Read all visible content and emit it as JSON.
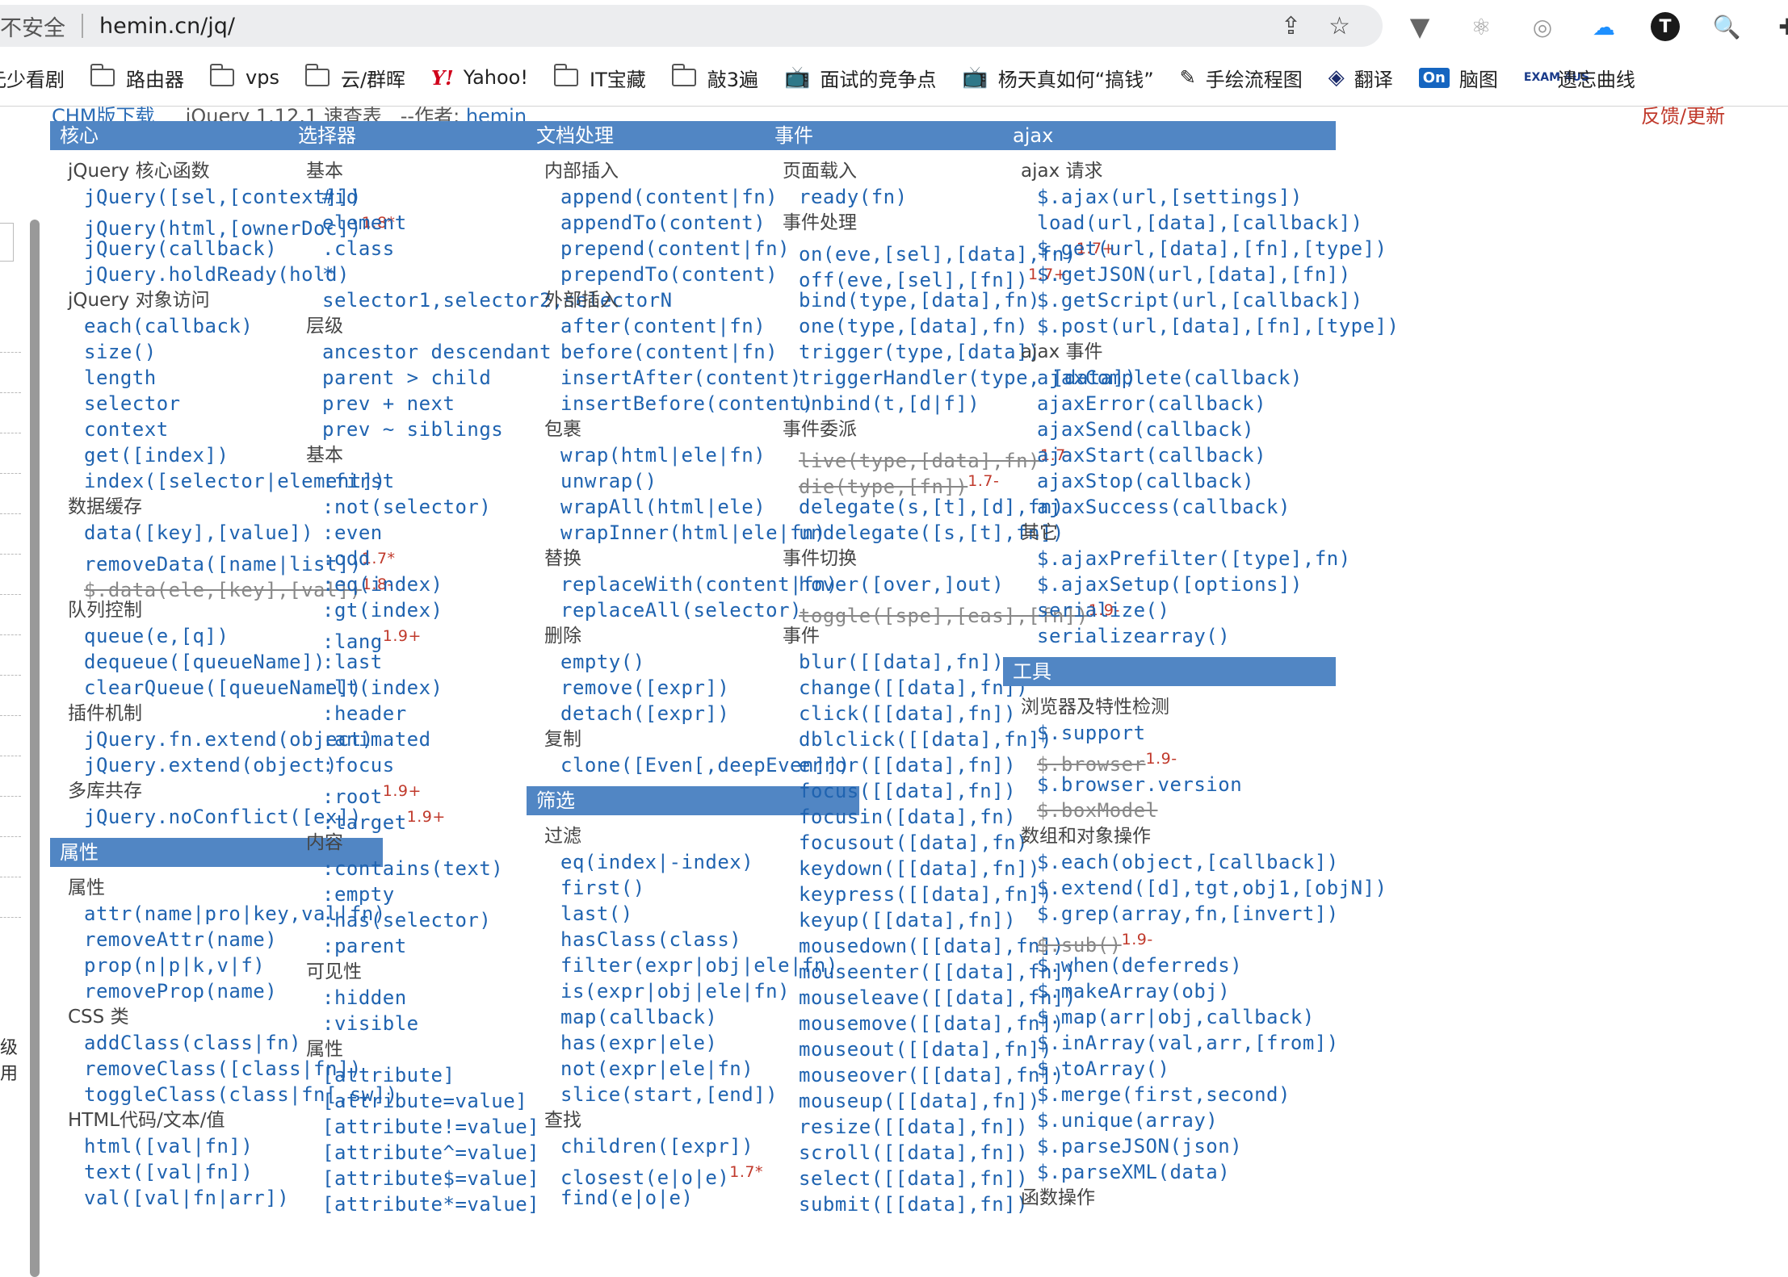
{
  "browser": {
    "security_text": "不安全",
    "url": "hemin.cn/jq/",
    "share_icon": "share-icon",
    "bookmark_star_icon": "star-icon",
    "extensions": [
      "vivaldi-icon",
      "react-icon",
      "camera-icon",
      "cloud-icon",
      "typora-icon",
      "zoom-icon",
      "puzzle-icon"
    ],
    "ext_glyph_t": "T"
  },
  "bookmarks": [
    {
      "type": "text",
      "label": "元少看剧"
    },
    {
      "type": "folder",
      "label": "路由器"
    },
    {
      "type": "folder",
      "label": "vps"
    },
    {
      "type": "folder",
      "label": "云/群晖"
    },
    {
      "type": "yahoo",
      "icon": "Y!",
      "label": "Yahoo!"
    },
    {
      "type": "folder",
      "label": "IT宝藏"
    },
    {
      "type": "folder",
      "label": "敲3遍"
    },
    {
      "type": "tv",
      "icon": "📺",
      "label": "面试的竞争点"
    },
    {
      "type": "tv",
      "icon": "📺",
      "label": "杨天真如何“搞钱”"
    },
    {
      "type": "pen",
      "icon": "✎",
      "label": "手绘流程图"
    },
    {
      "type": "fan",
      "icon": "◈",
      "label": "翻译"
    },
    {
      "type": "on",
      "icon": "On",
      "label": "脑图"
    },
    {
      "type": "exam",
      "icon": "EXAM 4US",
      "label": "遗忘曲线"
    }
  ],
  "sidebar": {
    "chars": [
      "级",
      "用"
    ]
  },
  "header": {
    "left_link": "CHM版下载",
    "title": "jQuery 1.12.1 速查表",
    "author_label": "--作者:",
    "author": "hemin",
    "right_link": "反馈/更新"
  },
  "columns": [
    {
      "blocks": [
        {
          "head": "核心",
          "groups": [
            {
              "sub": "jQuery 核心函数",
              "items": [
                {
                  "t": "jQuery([sel,[context]])"
                },
                {
                  "t": "jQuery(html,[ownerDoc])",
                  "v": "1.8*"
                },
                {
                  "t": "jQuery(callback)"
                },
                {
                  "t": "jQuery.holdReady(hold)"
                }
              ]
            },
            {
              "sub": "jQuery 对象访问",
              "items": [
                {
                  "t": "each(callback)"
                },
                {
                  "t": "size()"
                },
                {
                  "t": "length"
                },
                {
                  "t": "selector"
                },
                {
                  "t": "context"
                },
                {
                  "t": "get([index])"
                },
                {
                  "t": "index([selector|element])"
                }
              ]
            },
            {
              "sub": "数据缓存",
              "items": [
                {
                  "t": "data([key],[value])"
                },
                {
                  "t": "removeData([name|list])",
                  "v": "1.7*"
                },
                {
                  "t": "$.data(ele,[key],[val])",
                  "v": "1.8-",
                  "strike": true
                }
              ]
            },
            {
              "sub": "队列控制",
              "items": [
                {
                  "t": "queue(e,[q])"
                },
                {
                  "t": "dequeue([queueName])"
                },
                {
                  "t": "clearQueue([queueName])"
                }
              ]
            },
            {
              "sub": "插件机制",
              "items": [
                {
                  "t": "jQuery.fn.extend(object)"
                },
                {
                  "t": "jQuery.extend(object)"
                }
              ]
            },
            {
              "sub": "多库共存",
              "items": [
                {
                  "t": "jQuery.noConflict([ex])"
                }
              ]
            }
          ]
        },
        {
          "head": "属性",
          "groups": [
            {
              "sub": "属性",
              "items": [
                {
                  "t": "attr(name|pro|key,val|fn)"
                },
                {
                  "t": "removeAttr(name)"
                },
                {
                  "t": "prop(n|p|k,v|f)"
                },
                {
                  "t": "removeProp(name)"
                }
              ]
            },
            {
              "sub": "CSS 类",
              "items": [
                {
                  "t": "addClass(class|fn)"
                },
                {
                  "t": "removeClass([class|fn])"
                },
                {
                  "t": "toggleClass(class|fn[,sw])"
                }
              ]
            },
            {
              "sub": "HTML代码/文本/值",
              "items": [
                {
                  "t": "html([val|fn])"
                },
                {
                  "t": "text([val|fn])"
                },
                {
                  "t": "val([val|fn|arr])"
                }
              ]
            }
          ]
        }
      ]
    },
    {
      "blocks": [
        {
          "head": "选择器",
          "groups": [
            {
              "sub": "基本",
              "items": [
                {
                  "t": "#id"
                },
                {
                  "t": "element"
                },
                {
                  "t": ".class"
                },
                {
                  "t": "*"
                },
                {
                  "t": "selector1,selector2,selectorN"
                }
              ]
            },
            {
              "sub": "层级",
              "items": [
                {
                  "t": "ancestor descendant"
                },
                {
                  "t": "parent > child"
                },
                {
                  "t": "prev + next"
                },
                {
                  "t": "prev ~ siblings"
                }
              ]
            },
            {
              "sub": "基本",
              "items": [
                {
                  "t": ":first"
                },
                {
                  "t": ":not(selector)"
                },
                {
                  "t": ":even"
                },
                {
                  "t": ":odd"
                },
                {
                  "t": ":eq(index)"
                },
                {
                  "t": ":gt(index)"
                },
                {
                  "t": ":lang",
                  "v": "1.9+"
                },
                {
                  "t": ":last"
                },
                {
                  "t": ":lt(index)"
                },
                {
                  "t": ":header"
                },
                {
                  "t": ":animated"
                },
                {
                  "t": ":focus"
                },
                {
                  "t": ":root",
                  "v": "1.9+"
                },
                {
                  "t": ":target",
                  "v": "1.9+"
                }
              ]
            },
            {
              "sub": "内容",
              "items": [
                {
                  "t": ":contains(text)"
                },
                {
                  "t": ":empty"
                },
                {
                  "t": ":has(selector)"
                },
                {
                  "t": ":parent"
                }
              ]
            },
            {
              "sub": "可见性",
              "items": [
                {
                  "t": ":hidden"
                },
                {
                  "t": ":visible"
                }
              ]
            },
            {
              "sub": "属性",
              "items": [
                {
                  "t": "[attribute]"
                },
                {
                  "t": "[attribute=value]"
                },
                {
                  "t": "[attribute!=value]"
                },
                {
                  "t": "[attribute^=value]"
                },
                {
                  "t": "[attribute$=value]"
                },
                {
                  "t": "[attribute*=value]"
                }
              ]
            }
          ]
        }
      ]
    },
    {
      "blocks": [
        {
          "head": "文档处理",
          "groups": [
            {
              "sub": "内部插入",
              "items": [
                {
                  "t": "append(content|fn)"
                },
                {
                  "t": "appendTo(content)"
                },
                {
                  "t": "prepend(content|fn)"
                },
                {
                  "t": "prependTo(content)"
                }
              ]
            },
            {
              "sub": "外部插入",
              "items": [
                {
                  "t": "after(content|fn)"
                },
                {
                  "t": "before(content|fn)"
                },
                {
                  "t": "insertAfter(content)"
                },
                {
                  "t": "insertBefore(content)"
                }
              ]
            },
            {
              "sub": "包裹",
              "items": [
                {
                  "t": "wrap(html|ele|fn)"
                },
                {
                  "t": "unwrap()"
                },
                {
                  "t": "wrapAll(html|ele)"
                },
                {
                  "t": "wrapInner(html|ele|fn)"
                }
              ]
            },
            {
              "sub": "替换",
              "items": [
                {
                  "t": "replaceWith(content|fn)"
                },
                {
                  "t": "replaceAll(selector)"
                }
              ]
            },
            {
              "sub": "删除",
              "items": [
                {
                  "t": "empty()"
                },
                {
                  "t": "remove([expr])"
                },
                {
                  "t": "detach([expr])"
                }
              ]
            },
            {
              "sub": "复制",
              "items": [
                {
                  "t": "clone([Even[,deepEven]])"
                }
              ]
            }
          ]
        },
        {
          "head": "筛选",
          "groups": [
            {
              "sub": "过滤",
              "items": [
                {
                  "t": "eq(index|-index)"
                },
                {
                  "t": "first()"
                },
                {
                  "t": "last()"
                },
                {
                  "t": "hasClass(class)"
                },
                {
                  "t": "filter(expr|obj|ele|fn)"
                },
                {
                  "t": "is(expr|obj|ele|fn)"
                },
                {
                  "t": "map(callback)"
                },
                {
                  "t": "has(expr|ele)"
                },
                {
                  "t": "not(expr|ele|fn)"
                },
                {
                  "t": "slice(start,[end])"
                }
              ]
            },
            {
              "sub": "查找",
              "items": [
                {
                  "t": "children([expr])"
                },
                {
                  "t": "closest(e|o|e)",
                  "v": "1.7*"
                },
                {
                  "t": "find(e|o|e)"
                }
              ]
            }
          ]
        }
      ]
    },
    {
      "blocks": [
        {
          "head": "事件",
          "groups": [
            {
              "sub": "页面载入",
              "items": [
                {
                  "t": "ready(fn)"
                }
              ]
            },
            {
              "sub": "事件处理",
              "items": [
                {
                  "t": "on(eve,[sel],[data],fn)",
                  "v": "1.7+"
                },
                {
                  "t": "off(eve,[sel],[fn])",
                  "v": "1.7+"
                },
                {
                  "t": "bind(type,[data],fn)"
                },
                {
                  "t": "one(type,[data],fn)"
                },
                {
                  "t": "trigger(type,[data])"
                },
                {
                  "t": "triggerHandler(type, [data])"
                },
                {
                  "t": "unbind(t,[d|f])"
                }
              ]
            },
            {
              "sub": "事件委派",
              "items": [
                {
                  "t": "live(type,[data],fn)",
                  "v": "1.7-",
                  "strike": true
                },
                {
                  "t": "die(type,[fn])",
                  "v": "1.7-",
                  "strike": true
                },
                {
                  "t": "delegate(s,[t],[d],fn)"
                },
                {
                  "t": "undelegate([s,[t],fn])"
                }
              ]
            },
            {
              "sub": "事件切换",
              "items": [
                {
                  "t": "hover([over,]out)"
                },
                {
                  "t": "toggle([spe],[eas],[fn])",
                  "v": "1.9-",
                  "strike": true
                }
              ]
            },
            {
              "sub": "事件",
              "items": [
                {
                  "t": "blur([[data],fn])"
                },
                {
                  "t": "change([[data],fn])"
                },
                {
                  "t": "click([[data],fn])"
                },
                {
                  "t": "dblclick([[data],fn])"
                },
                {
                  "t": "error([[data],fn])"
                },
                {
                  "t": "focus([[data],fn])"
                },
                {
                  "t": "focusin([data],fn)"
                },
                {
                  "t": "focusout([data],fn)"
                },
                {
                  "t": "keydown([[data],fn])"
                },
                {
                  "t": "keypress([[data],fn])"
                },
                {
                  "t": "keyup([[data],fn])"
                },
                {
                  "t": "mousedown([[data],fn])"
                },
                {
                  "t": "mouseenter([[data],fn])"
                },
                {
                  "t": "mouseleave([[data],fn])"
                },
                {
                  "t": "mousemove([[data],fn])"
                },
                {
                  "t": "mouseout([[data],fn])"
                },
                {
                  "t": "mouseover([[data],fn])"
                },
                {
                  "t": "mouseup([[data],fn])"
                },
                {
                  "t": "resize([[data],fn])"
                },
                {
                  "t": "scroll([[data],fn])"
                },
                {
                  "t": "select([[data],fn])"
                },
                {
                  "t": "submit([[data],fn])"
                }
              ]
            }
          ]
        }
      ]
    },
    {
      "blocks": [
        {
          "head": "ajax",
          "groups": [
            {
              "sub": "ajax 请求",
              "items": [
                {
                  "t": "$.ajax(url,[settings])"
                },
                {
                  "t": "load(url,[data],[callback])"
                },
                {
                  "t": "$.get(url,[data],[fn],[type])"
                },
                {
                  "t": "$.getJSON(url,[data],[fn])"
                },
                {
                  "t": "$.getScript(url,[callback])"
                },
                {
                  "t": "$.post(url,[data],[fn],[type])"
                }
              ]
            },
            {
              "sub": "ajax 事件",
              "items": [
                {
                  "t": "ajaxComplete(callback)"
                },
                {
                  "t": "ajaxError(callback)"
                },
                {
                  "t": "ajaxSend(callback)"
                },
                {
                  "t": "ajaxStart(callback)"
                },
                {
                  "t": "ajaxStop(callback)"
                },
                {
                  "t": "ajaxSuccess(callback)"
                }
              ]
            },
            {
              "sub": "其它",
              "items": [
                {
                  "t": "$.ajaxPrefilter([type],fn)"
                },
                {
                  "t": "$.ajaxSetup([options])"
                },
                {
                  "t": "serialize()"
                },
                {
                  "t": "serializearray()"
                }
              ]
            }
          ]
        },
        {
          "head": "工具",
          "groups": [
            {
              "sub": "浏览器及特性检测",
              "items": [
                {
                  "t": "$.support"
                },
                {
                  "t": "$.browser",
                  "v": "1.9-",
                  "strike": true
                },
                {
                  "t": "$.browser.version"
                },
                {
                  "t": "$.boxModel",
                  "strike": true
                }
              ]
            },
            {
              "sub": "数组和对象操作",
              "items": [
                {
                  "t": "$.each(object,[callback])"
                },
                {
                  "t": "$.extend([d],tgt,obj1,[objN])"
                },
                {
                  "t": "$.grep(array,fn,[invert])"
                },
                {
                  "t": "$.sub()",
                  "v": "1.9-",
                  "strike": true
                },
                {
                  "t": "$.when(deferreds)"
                },
                {
                  "t": "$.makeArray(obj)"
                },
                {
                  "t": "$.map(arr|obj,callback)"
                },
                {
                  "t": "$.inArray(val,arr,[from])"
                },
                {
                  "t": "$.toArray()"
                },
                {
                  "t": "$.merge(first,second)"
                },
                {
                  "t": "$.unique(array)"
                },
                {
                  "t": "$.parseJSON(json)"
                },
                {
                  "t": "$.parseXML(data)"
                }
              ]
            },
            {
              "sub": "函数操作",
              "items": []
            }
          ]
        }
      ]
    }
  ]
}
